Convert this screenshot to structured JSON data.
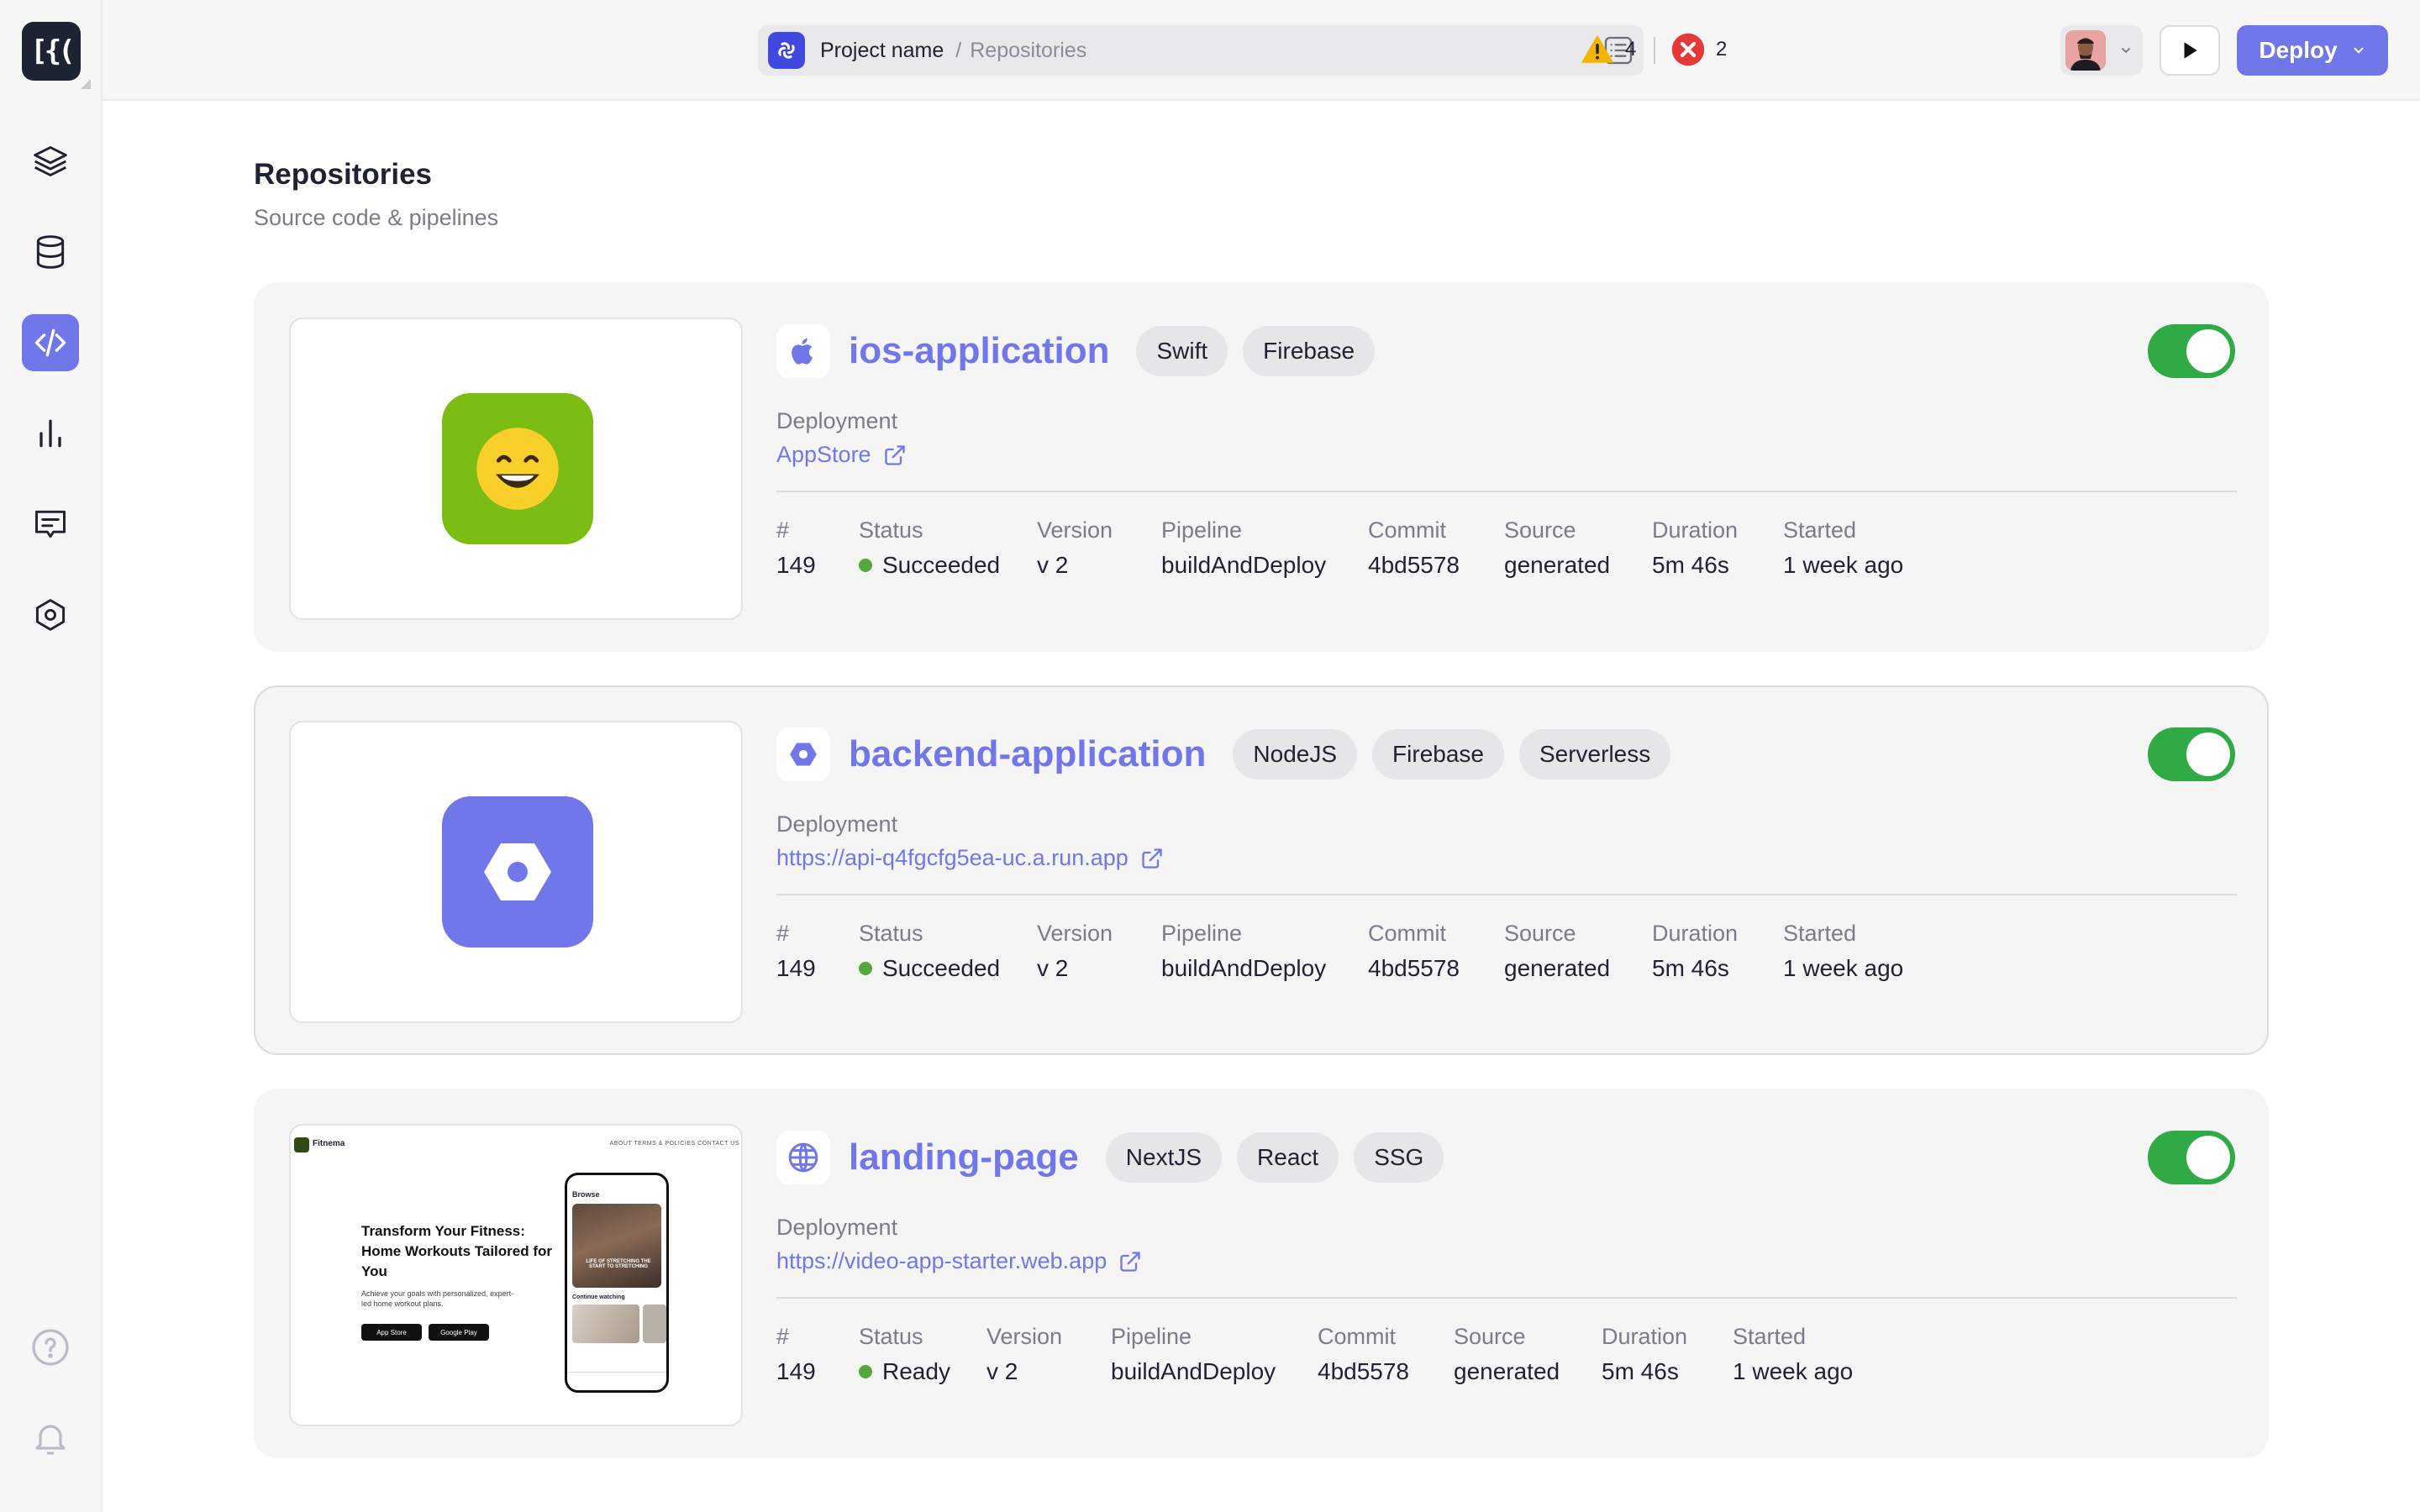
{
  "app": {
    "logo_text": "[{(",
    "project_name": "Project name",
    "breadcrumb_sep": "/",
    "breadcrumb_page": "Repositories"
  },
  "alerts": {
    "warnings": "4",
    "errors": "2"
  },
  "toolbar": {
    "deploy_label": "Deploy"
  },
  "page": {
    "title": "Repositories",
    "subtitle": "Source code & pipelines"
  },
  "labels": {
    "deployment": "Deployment",
    "num": "#",
    "status": "Status",
    "version": "Version",
    "pipeline": "Pipeline",
    "commit": "Commit",
    "source": "Source",
    "duration": "Duration",
    "started": "Started"
  },
  "repos": [
    {
      "name": "ios-application",
      "tags": [
        "Swift",
        "Firebase"
      ],
      "deployment": "AppStore",
      "enabled": true,
      "run": {
        "num": "149",
        "status": "Succeeded",
        "version": "v 2",
        "pipeline": "buildAndDeploy",
        "commit": "4bd5578",
        "source": "generated",
        "duration": "5m 46s",
        "started": "1 week ago"
      }
    },
    {
      "name": "backend-application",
      "tags": [
        "NodeJS",
        "Firebase",
        "Serverless"
      ],
      "deployment": "https://api-q4fgcfg5ea-uc.a.run.app",
      "enabled": true,
      "run": {
        "num": "149",
        "status": "Succeeded",
        "version": "v 2",
        "pipeline": "buildAndDeploy",
        "commit": "4bd5578",
        "source": "generated",
        "duration": "5m 46s",
        "started": "1 week ago"
      }
    },
    {
      "name": "landing-page",
      "tags": [
        "NextJS",
        "React",
        "SSG"
      ],
      "deployment": "https://video-app-starter.web.app",
      "enabled": true,
      "run": {
        "num": "149",
        "status": "Ready",
        "version": "v 2",
        "pipeline": "buildAndDeploy",
        "commit": "4bd5578",
        "source": "generated",
        "duration": "5m 46s",
        "started": "1 week ago"
      }
    }
  ],
  "landing_preview": {
    "brand": "Fitnema",
    "nav": "ABOUT    TERMS & POLICIES    CONTACT US",
    "hero": "Transform Your Fitness: Home Workouts Tailored for You",
    "text": "Achieve your goals with personalized, expert-led home workout plans.",
    "store_apple": "App Store",
    "store_google": "Google Play",
    "phone_browse": "Browse",
    "phone_caption": "LIFE OF STRETCHING THE START TO STRETCHING",
    "phone_continue": "Continue watching"
  },
  "colors": {
    "accent": "#7177e8",
    "success": "#2faa45",
    "warning": "#f5b400",
    "error": "#e5383b"
  }
}
